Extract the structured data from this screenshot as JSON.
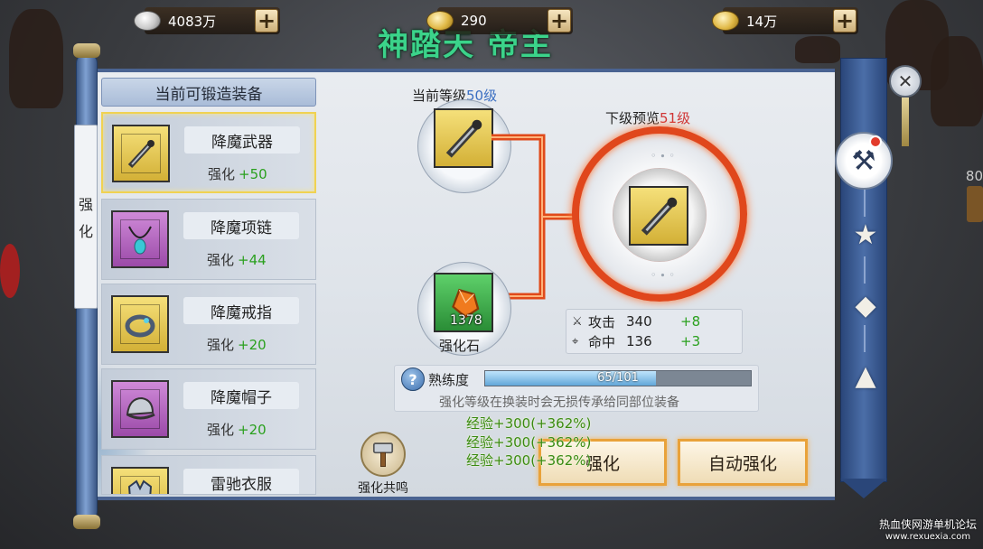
{
  "currencies": [
    {
      "icon": "silver-coin-icon",
      "value": "4083万"
    },
    {
      "icon": "gold-ingot-icon",
      "value": "290"
    },
    {
      "icon": "gold-coin-icon",
      "value": "14万"
    }
  ],
  "scene": {
    "banner": "神踏天 帝主",
    "side_number": "80"
  },
  "side_tab": {
    "chars": [
      "强",
      "化"
    ]
  },
  "equipment_list": {
    "header": "当前可锻造装备",
    "level_prefix": "强化",
    "items": [
      {
        "name": "降魔武器",
        "bonus": "+50",
        "icon": "sword-icon",
        "rarity": "gold",
        "selected": true
      },
      {
        "name": "降魔项链",
        "bonus": "+44",
        "icon": "necklace-icon",
        "rarity": "purple",
        "selected": false
      },
      {
        "name": "降魔戒指",
        "bonus": "+20",
        "icon": "ring-icon",
        "rarity": "gold",
        "selected": false
      },
      {
        "name": "降魔帽子",
        "bonus": "+20",
        "icon": "helmet-icon",
        "rarity": "purple",
        "selected": false
      },
      {
        "name": "雷驰衣服",
        "bonus": "",
        "icon": "armor-icon",
        "rarity": "gold",
        "selected": false
      }
    ]
  },
  "forge": {
    "current_label": "当前等级",
    "current_level": "50级",
    "next_label": "下级预览",
    "next_level": "51级",
    "stone_count": "1378",
    "stone_label": "强化石",
    "stats": [
      {
        "icon": "sword-stat-icon",
        "name": "攻击",
        "value": "340",
        "add": "+8"
      },
      {
        "icon": "crosshair-icon",
        "name": "命中",
        "value": "136",
        "add": "+3"
      }
    ]
  },
  "proficiency": {
    "label": "熟练度",
    "text": "65/101",
    "progress": 0.644,
    "note": "强化等级在换装时会无损传承给同部位装备"
  },
  "exp_gains": [
    "经验+300(+362%)",
    "经验+300(+362%)",
    "经验+300(+362%)"
  ],
  "buttons": {
    "resonance": "强化共鸣",
    "forge": "强化",
    "auto_forge": "自动强化"
  },
  "colors": {
    "accent_green": "#2aa01e",
    "accent_blue": "#3b6fc2",
    "accent_red": "#d03535",
    "button_border": "#e9a23a"
  },
  "watermark": {
    "line1": "热血侠网游单机论坛",
    "line2": "www.rexuexia.com"
  }
}
